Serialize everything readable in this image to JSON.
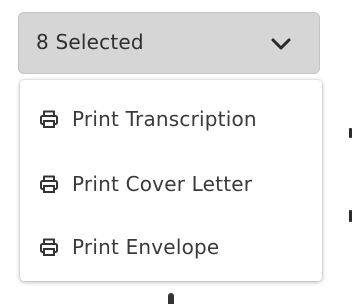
{
  "dropdown": {
    "selected_label": "8 Selected",
    "toggle_icon": "chevron-down-icon"
  },
  "menu": {
    "items": [
      {
        "label": "Print Transcription",
        "icon": "printer-icon"
      },
      {
        "label": "Print Cover Letter",
        "icon": "printer-icon"
      },
      {
        "label": "Print Envelope",
        "icon": "printer-icon"
      }
    ]
  },
  "colors": {
    "button_bg": "#d6d6d6",
    "text": "#3a3a3a",
    "menu_bg": "#ffffff"
  }
}
